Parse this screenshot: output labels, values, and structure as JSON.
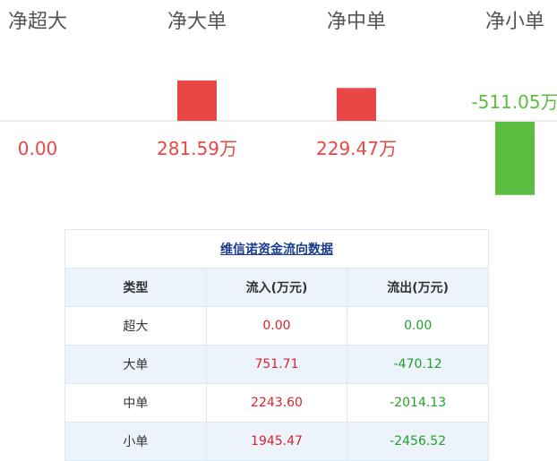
{
  "chart_data": {
    "type": "bar",
    "categories": [
      "净超大",
      "净大单",
      "净中单",
      "净小单"
    ],
    "values": [
      0.0,
      281.59,
      229.47,
      -511.05
    ],
    "value_labels": [
      "0.00",
      "281.59万",
      "229.47万",
      "-511.05万"
    ],
    "unit": "万",
    "colors": {
      "positive": "#e94646",
      "negative": "#5cbe40",
      "zero": "#e94646"
    },
    "grid": false,
    "legend": "none"
  },
  "table": {
    "title": "维信诺资金流向数据",
    "headers": [
      "类型",
      "流入(万元)",
      "流出(万元)"
    ],
    "rows": [
      {
        "type": "超大",
        "inflow": "0.00",
        "outflow": "0.00"
      },
      {
        "type": "大单",
        "inflow": "751.71",
        "outflow": "-470.12"
      },
      {
        "type": "中单",
        "inflow": "2243.60",
        "outflow": "-2014.13"
      },
      {
        "type": "小单",
        "inflow": "1945.47",
        "outflow": "-2456.52"
      }
    ]
  }
}
